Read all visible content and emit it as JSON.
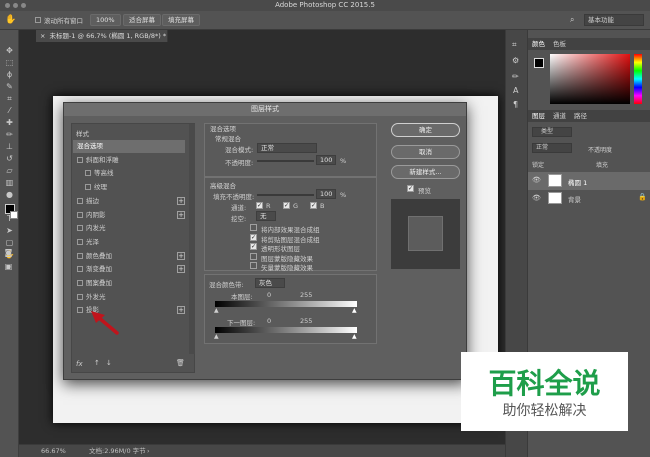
{
  "app": {
    "title": "Adobe Photoshop CC 2015.5"
  },
  "options_bar": {
    "scroll_all_windows_label": "滚动所有窗口",
    "zoom_100": "100%",
    "fit_screen": "适合屏幕",
    "fill_screen": "填充屏幕",
    "workspace": "基本功能"
  },
  "document": {
    "tab_title": "未标题-1 @ 66.7% (椭圆 1, RGB/8*) *"
  },
  "status": {
    "zoom": "66.67%",
    "doc_info": "文档:2.96M/0 字节"
  },
  "color_panel": {
    "tabs": [
      "颜色",
      "色板"
    ]
  },
  "layers_panel": {
    "tabs": [
      "图层",
      "通道",
      "路径"
    ],
    "kind_filter": "类型",
    "blend_mode": "正常",
    "opacity_label": "不透明度",
    "lock_label": "锁定",
    "fill_label": "填充",
    "layers": [
      {
        "name": "椭圆 1"
      },
      {
        "name": "背景"
      }
    ]
  },
  "dialog": {
    "title": "图层样式",
    "styles_header": "样式",
    "style_items": [
      {
        "label": "混合选项",
        "checkbox": false,
        "plus": false,
        "indent": false,
        "selected": true
      },
      {
        "label": "斜面和浮雕",
        "checkbox": true,
        "plus": false,
        "indent": false
      },
      {
        "label": "等高线",
        "checkbox": true,
        "plus": false,
        "indent": true
      },
      {
        "label": "纹理",
        "checkbox": true,
        "plus": false,
        "indent": true
      },
      {
        "label": "描边",
        "checkbox": true,
        "plus": true,
        "indent": false
      },
      {
        "label": "内阴影",
        "checkbox": true,
        "plus": true,
        "indent": false
      },
      {
        "label": "内发光",
        "checkbox": true,
        "plus": false,
        "indent": false
      },
      {
        "label": "光泽",
        "checkbox": true,
        "plus": false,
        "indent": false
      },
      {
        "label": "颜色叠加",
        "checkbox": true,
        "plus": true,
        "indent": false
      },
      {
        "label": "渐变叠加",
        "checkbox": true,
        "plus": true,
        "indent": false
      },
      {
        "label": "图案叠加",
        "checkbox": true,
        "plus": false,
        "indent": false
      },
      {
        "label": "外发光",
        "checkbox": true,
        "plus": false,
        "indent": false
      },
      {
        "label": "投影",
        "checkbox": true,
        "plus": true,
        "indent": false
      }
    ],
    "blend_options": {
      "title": "混合选项",
      "general_title": "常规混合",
      "blend_mode_label": "混合模式:",
      "blend_mode": "正常",
      "opacity_label": "不透明度:",
      "opacity": "100",
      "percent": "%"
    },
    "advanced": {
      "title": "高级混合",
      "fill_opacity_label": "填充不透明度:",
      "fill_opacity": "100",
      "percent": "%",
      "channels_label": "通道:",
      "channel_r": "R",
      "channel_g": "G",
      "channel_b": "B",
      "knockout_label": "挖空:",
      "knockout": "无",
      "options": [
        {
          "label": "将内部效果混合成组",
          "checked": false
        },
        {
          "label": "将剪贴图层混合成组",
          "checked": true
        },
        {
          "label": "透明形状图层",
          "checked": true
        },
        {
          "label": "图层蒙版隐藏效果",
          "checked": false
        },
        {
          "label": "矢量蒙版隐藏效果",
          "checked": false
        }
      ]
    },
    "blend_if": {
      "label": "混合颜色带:",
      "value": "灰色",
      "this_layer_label": "本图层:",
      "this_layer_min": "0",
      "this_layer_max": "255",
      "below_label": "下一图层:",
      "below_min": "0",
      "below_max": "255"
    },
    "buttons": {
      "ok": "确定",
      "cancel": "取消",
      "new_style": "新建样式...",
      "preview": "预览"
    },
    "footer_fx": "fx"
  },
  "watermark": {
    "title": "百科全说",
    "subtitle": "助你轻松解决"
  },
  "colors": {
    "accent_arrow": "#c0141c",
    "watermark_green": "#1e9e4a"
  }
}
